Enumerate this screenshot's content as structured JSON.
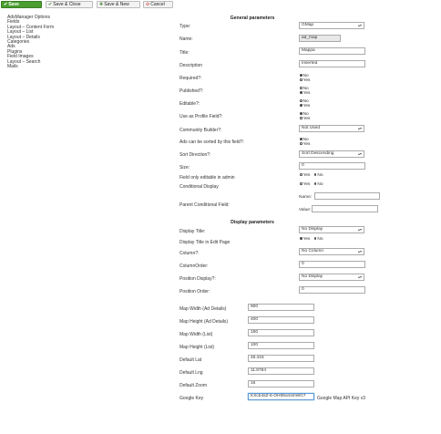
{
  "toolbar": {
    "save": "Save",
    "save_close": "Save & Close",
    "save_new": "Save & New",
    "cancel": "Cancel"
  },
  "sidebar": {
    "items": [
      "AdsManager Options",
      "Fields",
      "Layout – Content Form",
      "Layout – List",
      "Layout – Details",
      "Categories",
      "Ads",
      "Plugins",
      "Field Images",
      "Layout – Search",
      "Mails"
    ]
  },
  "general": {
    "heading": "General parameters",
    "type_label": "Type:",
    "type_value": "GMap",
    "name_label": "Name:",
    "name_value": "ad_map",
    "title_label": "Title:",
    "title_value": "Mappa",
    "description_label": "Description",
    "description_value": "Inserted",
    "required_label": "Required?:",
    "published_label": "Published?:",
    "editable_label": "Editable?:",
    "profile_label": "Use as Profile Field?:",
    "no": "No",
    "yes": "Yes",
    "community_label": "Community Builder?:",
    "community_value": "Not Used",
    "sortable_label": "Ads can be sorted by this field?:",
    "sort_dir_label": "Sort Direction?:",
    "sort_dir_value": "Sort Descending",
    "size_label": "Size:",
    "size_value": "0",
    "admin_only_label": "Field only editable in admin",
    "conditional_label": "Conditional Display",
    "parent_cond_label": "Parent Conditional Field:",
    "cond_name_label": "Name:",
    "cond_value_label": "Value:",
    "cond_name_value": "",
    "cond_value_value": ""
  },
  "display": {
    "heading": "Display parameters",
    "display_title_label": "Display Title:",
    "display_title_value": "No Display",
    "title_edit_label": "Display Title in Edit Page",
    "column_label": "Column?:",
    "column_value": "No Column",
    "column_order_label": "ColumnOrder:",
    "column_order_value": "0",
    "position_label": "Position Display?:",
    "position_value": "No Display",
    "position_order_label": "Position Order:",
    "position_order_value": "0"
  },
  "map": {
    "width_details_label": "Map Width (Ad Details)",
    "width_details_value": "900",
    "height_details_label": "Map Height (Ad Details)",
    "height_details_value": "400",
    "width_list_label": "Map Width (List)",
    "width_list_value": "150",
    "height_list_label": "Map Height (List)",
    "height_list_value": "100",
    "lat_label": "Default Lat",
    "lat_value": "45.415",
    "lng_label": "Default Lng",
    "lng_value": "11.8784",
    "zoom_label": "Default Zoom",
    "zoom_value": "16",
    "key_label": "Google Key",
    "key_value": "KXcb4sZ-6-OH99omlmWG7",
    "key_note": "Google Map API Key v3"
  },
  "colors": {
    "save_green": "#4a9e2f",
    "readonly_gray": "#e8e8e8"
  }
}
